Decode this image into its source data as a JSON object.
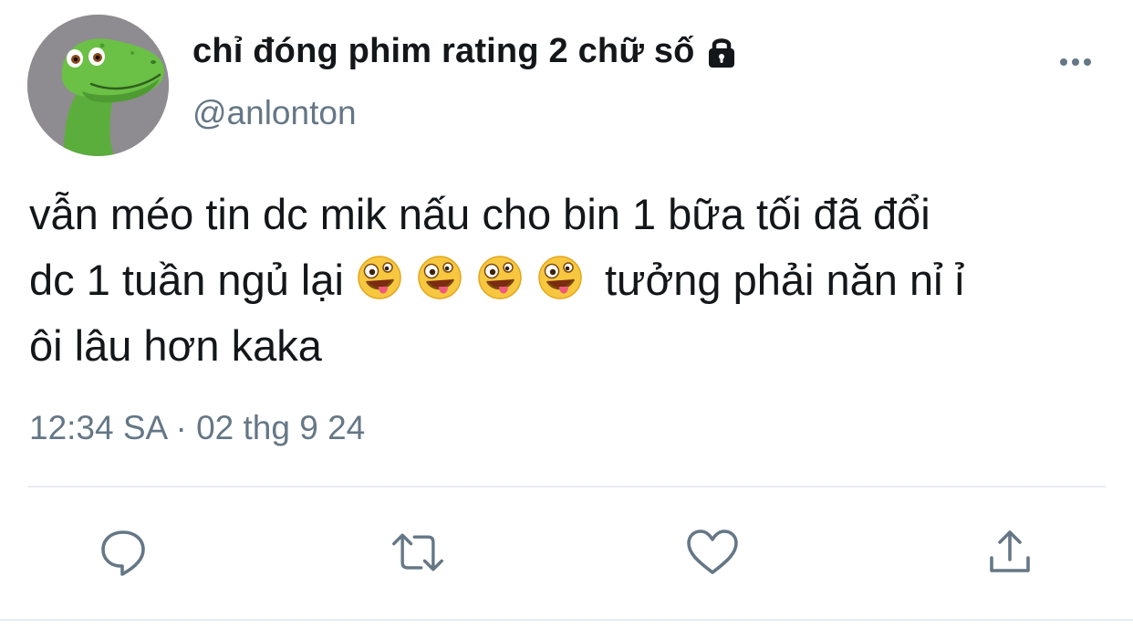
{
  "user": {
    "display_name": "chỉ đóng phim rating 2 chữ số",
    "handle": "@anlonton"
  },
  "tweet": {
    "line1": "vẫn méo tin dc mik nấu cho bin 1 bữa tối đã đổi",
    "line2_start": "dc 1 tuần ngủ lại",
    "line2_end": "tưởng phải năn nỉ ỉ",
    "line3": "ôi lâu hơn kaka",
    "emojis": [
      "zany-face",
      "zany-face",
      "zany-face",
      "zany-face"
    ]
  },
  "timestamp": "12:34 SA · 02 thg 9 24",
  "icons": {
    "avatar": "dinosaur-avatar",
    "protected": "lock-icon",
    "more": "more-icon",
    "reply": "reply-icon",
    "retweet": "retweet-icon",
    "like": "heart-icon",
    "share": "share-icon"
  },
  "colors": {
    "text": "#14171a",
    "secondary": "#657786",
    "divider": "#e6ecf0"
  }
}
